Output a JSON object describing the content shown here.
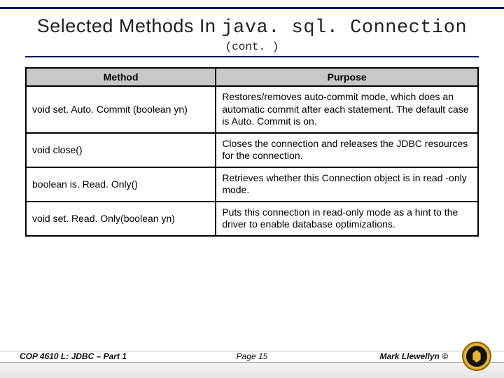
{
  "title_prefix": "Selected Methods In ",
  "title_mono": "java. sql. Connection",
  "subtitle": "(cont. )",
  "headers": {
    "method": "Method",
    "purpose": "Purpose"
  },
  "rows": [
    {
      "method": "void set. Auto. Commit (boolean yn)",
      "purpose": "Restores/removes auto-commit mode, which does an automatic commit after each statement.  The default case is Auto. Commit is on."
    },
    {
      "method": "void close()",
      "purpose": "Closes the connection and releases the JDBC resources for the connection."
    },
    {
      "method": "boolean is. Read. Only()",
      "purpose": "Retrieves whether this Connection object is in read -only mode."
    },
    {
      "method": "void set. Read. Only(boolean yn)",
      "purpose": "Puts this connection in read-only mode as a hint to the driver to enable database optimizations."
    }
  ],
  "footer": {
    "left": "COP 4610 L: JDBC – Part 1",
    "center": "Page 15",
    "right": "Mark Llewellyn ©"
  }
}
